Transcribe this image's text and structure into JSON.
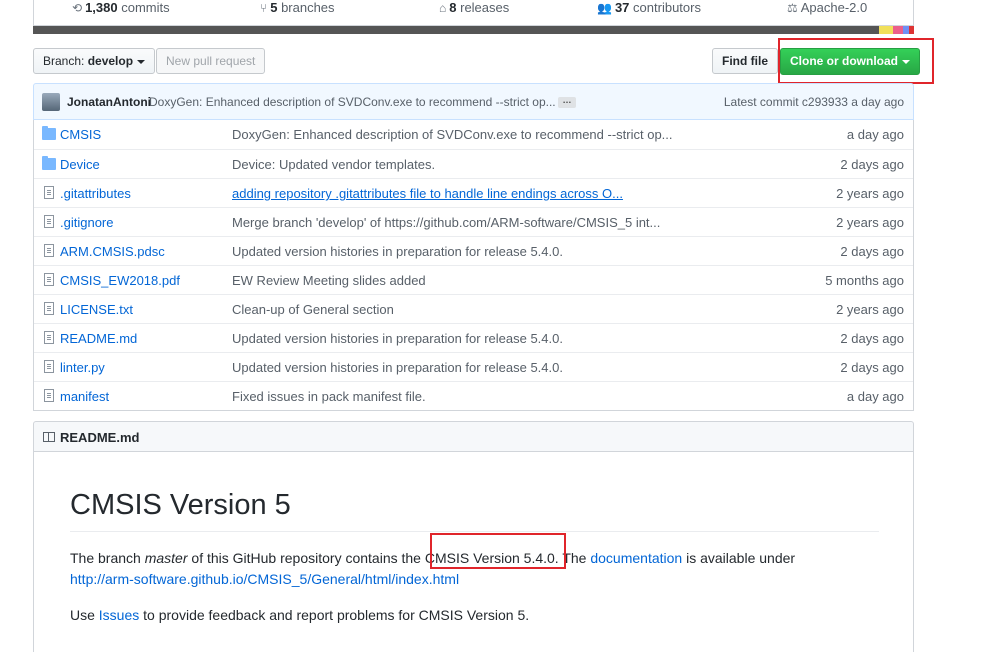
{
  "stats": {
    "commits_count": "1,380",
    "commits_label": "commits",
    "branches_count": "5",
    "branches_label": "branches",
    "releases_count": "8",
    "releases_label": "releases",
    "contributors_count": "37",
    "contributors_label": "contributors",
    "license": "Apache-2.0"
  },
  "language_colors": [
    "#555555",
    "#555555",
    "#e34c26",
    "#f1e05a",
    "#b07219",
    "#3572A5",
    "#f34b7d",
    "#4F5D95",
    "#178600"
  ],
  "toolbar": {
    "branch_prefix": "Branch:",
    "branch_name": "develop",
    "new_pull_request": "New pull request",
    "find_file": "Find file",
    "clone_or_download": "Clone or download"
  },
  "latest_commit": {
    "author": "JonatanAntoni",
    "message": "DoxyGen: Enhanced description of SVDConv.exe to recommend --strict op...",
    "ellipsis": "…",
    "info": "Latest commit c293933 a day ago"
  },
  "files": [
    {
      "type": "folder",
      "name": "CMSIS",
      "message": "DoxyGen: Enhanced description of SVDConv.exe to recommend --strict op...",
      "age": "a day ago"
    },
    {
      "type": "folder",
      "name": "Device",
      "message": "Device: Updated vendor templates.",
      "age": "2 days ago"
    },
    {
      "type": "file",
      "name": ".gitattributes",
      "message": "adding repository .gitattributes file to handle line endings across O...",
      "age": "2 years ago",
      "message_link": true
    },
    {
      "type": "file",
      "name": ".gitignore",
      "message": "Merge branch 'develop' of https://github.com/ARM-software/CMSIS_5 int...",
      "age": "2 years ago"
    },
    {
      "type": "file",
      "name": "ARM.CMSIS.pdsc",
      "message": "Updated version histories in preparation for release 5.4.0.",
      "age": "2 days ago"
    },
    {
      "type": "file",
      "name": "CMSIS_EW2018.pdf",
      "message": "EW Review Meeting slides added",
      "age": "5 months ago"
    },
    {
      "type": "file",
      "name": "LICENSE.txt",
      "message": "Clean-up of General section",
      "age": "2 years ago"
    },
    {
      "type": "file",
      "name": "README.md",
      "message": "Updated version histories in preparation for release 5.4.0.",
      "age": "2 days ago"
    },
    {
      "type": "file",
      "name": "linter.py",
      "message": "Updated version histories in preparation for release 5.4.0.",
      "age": "2 days ago"
    },
    {
      "type": "file",
      "name": "manifest",
      "message": "Fixed issues in pack manifest file.",
      "age": "a day ago"
    }
  ],
  "readme": {
    "header": "README.md",
    "title": "CMSIS Version 5",
    "p1_a": "The branch ",
    "p1_em": "master",
    "p1_b": " of this GitHub repository contains the ",
    "p1_highlight": "CMSIS Version 5.4.0.",
    "p1_c": " The ",
    "p1_link": "documentation",
    "p1_d": " is available under",
    "p2_url": "http://arm-software.github.io/CMSIS_5/General/html/index.html",
    "p3_a": "Use ",
    "p3_link": "Issues",
    "p3_b": " to provide feedback and report problems for CMSIS Version 5."
  }
}
